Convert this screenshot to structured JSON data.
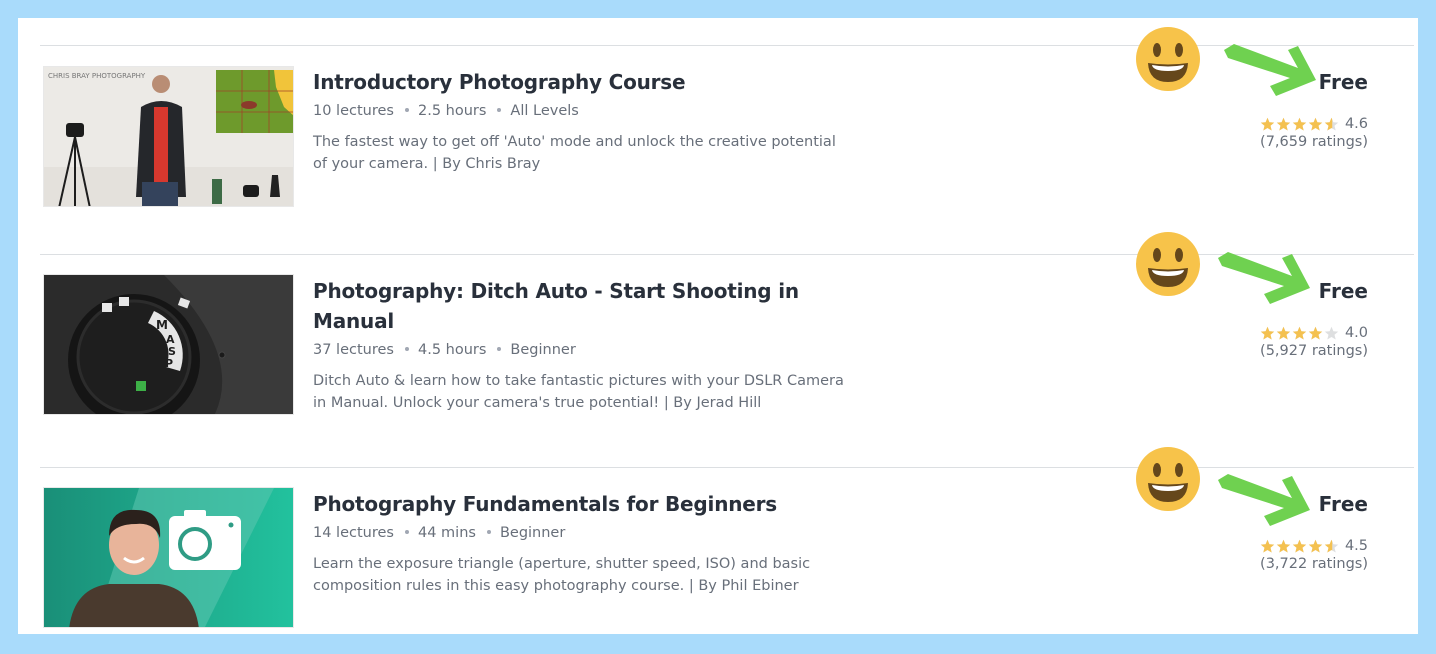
{
  "colors": {
    "background": "#a9dbfb",
    "star": "#f4c150",
    "star_empty": "#dedfe0",
    "arrow": "#6fd150",
    "smiley": "#f7c34a"
  },
  "courses": [
    {
      "title": "Introductory Photography Course",
      "lectures": "10 lectures",
      "duration": "2.5 hours",
      "level": "All Levels",
      "description": "The fastest way to get off 'Auto' mode and unlock the creative potential of your camera. | By Chris Bray",
      "price": "Free",
      "rating": 4.6,
      "rating_text": "4.6",
      "ratings_count": "(7,659 ratings)",
      "thumbnail": "camera-tripod-presenter-thumbnail",
      "thumbnail_caption": "CHRIS BRAY PHOTOGRAPHY"
    },
    {
      "title": "Photography: Ditch Auto - Start Shooting in Manual",
      "lectures": "37 lectures",
      "duration": "4.5 hours",
      "level": "Beginner",
      "description": "Ditch Auto & learn how to take fantastic pictures with your DSLR Camera in Manual. Unlock your camera's true potential! | By Jerad Hill",
      "price": "Free",
      "rating": 4.0,
      "rating_text": "4.0",
      "ratings_count": "(5,927 ratings)",
      "thumbnail": "camera-mode-dial-thumbnail",
      "thumbnail_caption": ""
    },
    {
      "title": "Photography Fundamentals for Beginners",
      "lectures": "14 lectures",
      "duration": "44 mins",
      "level": "Beginner",
      "description": "Learn the exposure triangle (aperture, shutter speed, ISO) and basic composition rules in this easy photography course. | By Phil Ebiner",
      "price": "Free",
      "rating": 4.5,
      "rating_text": "4.5",
      "ratings_count": "(3,722 ratings)",
      "thumbnail": "instructor-camera-icon-thumbnail",
      "thumbnail_caption": ""
    }
  ]
}
